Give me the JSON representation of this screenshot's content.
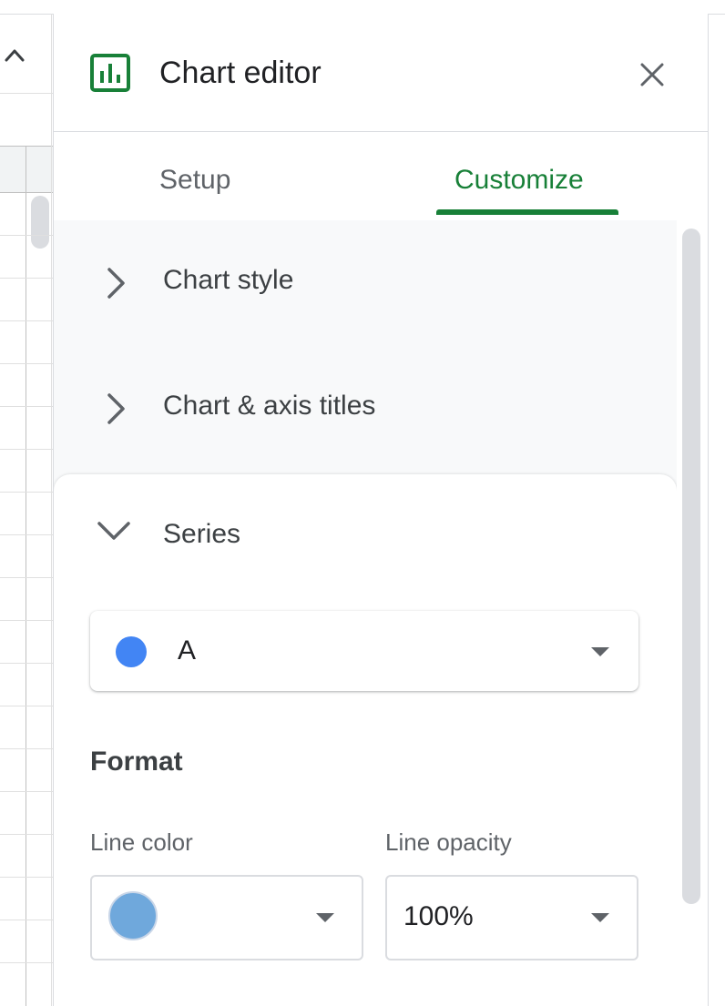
{
  "header": {
    "title": "Chart editor",
    "chart_icon": "bar-chart-icon",
    "close_icon": "close-icon"
  },
  "tabs": [
    {
      "label": "Setup",
      "active": false
    },
    {
      "label": "Customize",
      "active": true
    }
  ],
  "sections": [
    {
      "label": "Chart style",
      "expanded": false,
      "icon": "chevron-right-icon"
    },
    {
      "label": "Chart & axis titles",
      "expanded": false,
      "icon": "chevron-right-icon"
    },
    {
      "label": "Series",
      "expanded": true,
      "icon": "chevron-down-icon"
    }
  ],
  "series": {
    "selected": "A",
    "dot_color": "#4285f4",
    "format_title": "Format",
    "line_color_label": "Line color",
    "line_color_value": "#6fa8dc",
    "line_opacity_label": "Line opacity",
    "line_opacity_value": "100%"
  },
  "colors": {
    "accent": "#188038",
    "text": "#3c4043",
    "muted": "#5f6368",
    "divider": "#dadce0",
    "panel_bg": "#f8f9fa"
  }
}
